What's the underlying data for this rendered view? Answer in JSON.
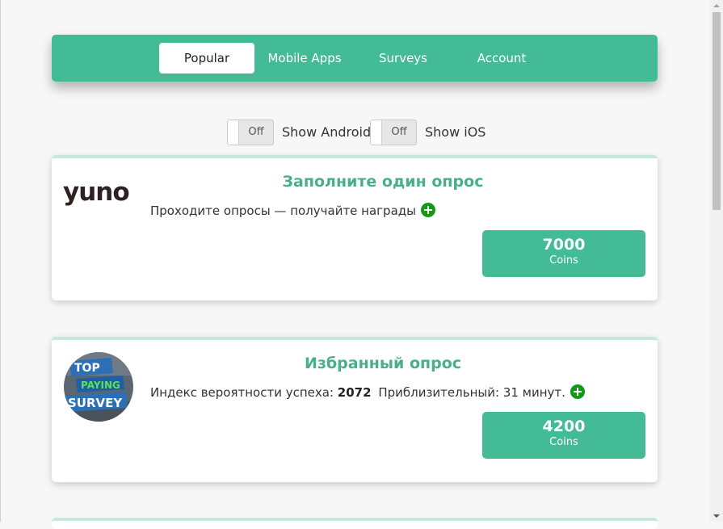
{
  "nav": {
    "tabs": [
      {
        "label": "Popular",
        "active": true
      },
      {
        "label": "Mobile Apps",
        "active": false
      },
      {
        "label": "Surveys",
        "active": false
      },
      {
        "label": "Account",
        "active": false
      }
    ]
  },
  "filters": {
    "android": {
      "state": "Off",
      "label": "Show Android"
    },
    "ios": {
      "state": "Off",
      "label": "Show iOS"
    }
  },
  "offers": [
    {
      "logo": "yuno",
      "title": "Заполните один опрос",
      "description": "Проходите опросы — получайте награды",
      "amount": "7000",
      "unit": "Coins"
    },
    {
      "logo": "TOP PAYING SURVEY",
      "logo_lines": [
        "TOP",
        "PAYING",
        "SURVEY"
      ],
      "title": "Избранный опрос",
      "success_label": "Индекс вероятности успеха:",
      "success_value": "2072",
      "time_text": "Приблизительный: 31 минут.",
      "amount": "4200",
      "unit": "Coins"
    }
  ],
  "colors": {
    "accent": "#43bb95",
    "title": "#49ae8d",
    "plus": "#119b14"
  },
  "icons": [
    "plus-circle-icon",
    "scroll-up-icon",
    "scroll-down-icon"
  ]
}
